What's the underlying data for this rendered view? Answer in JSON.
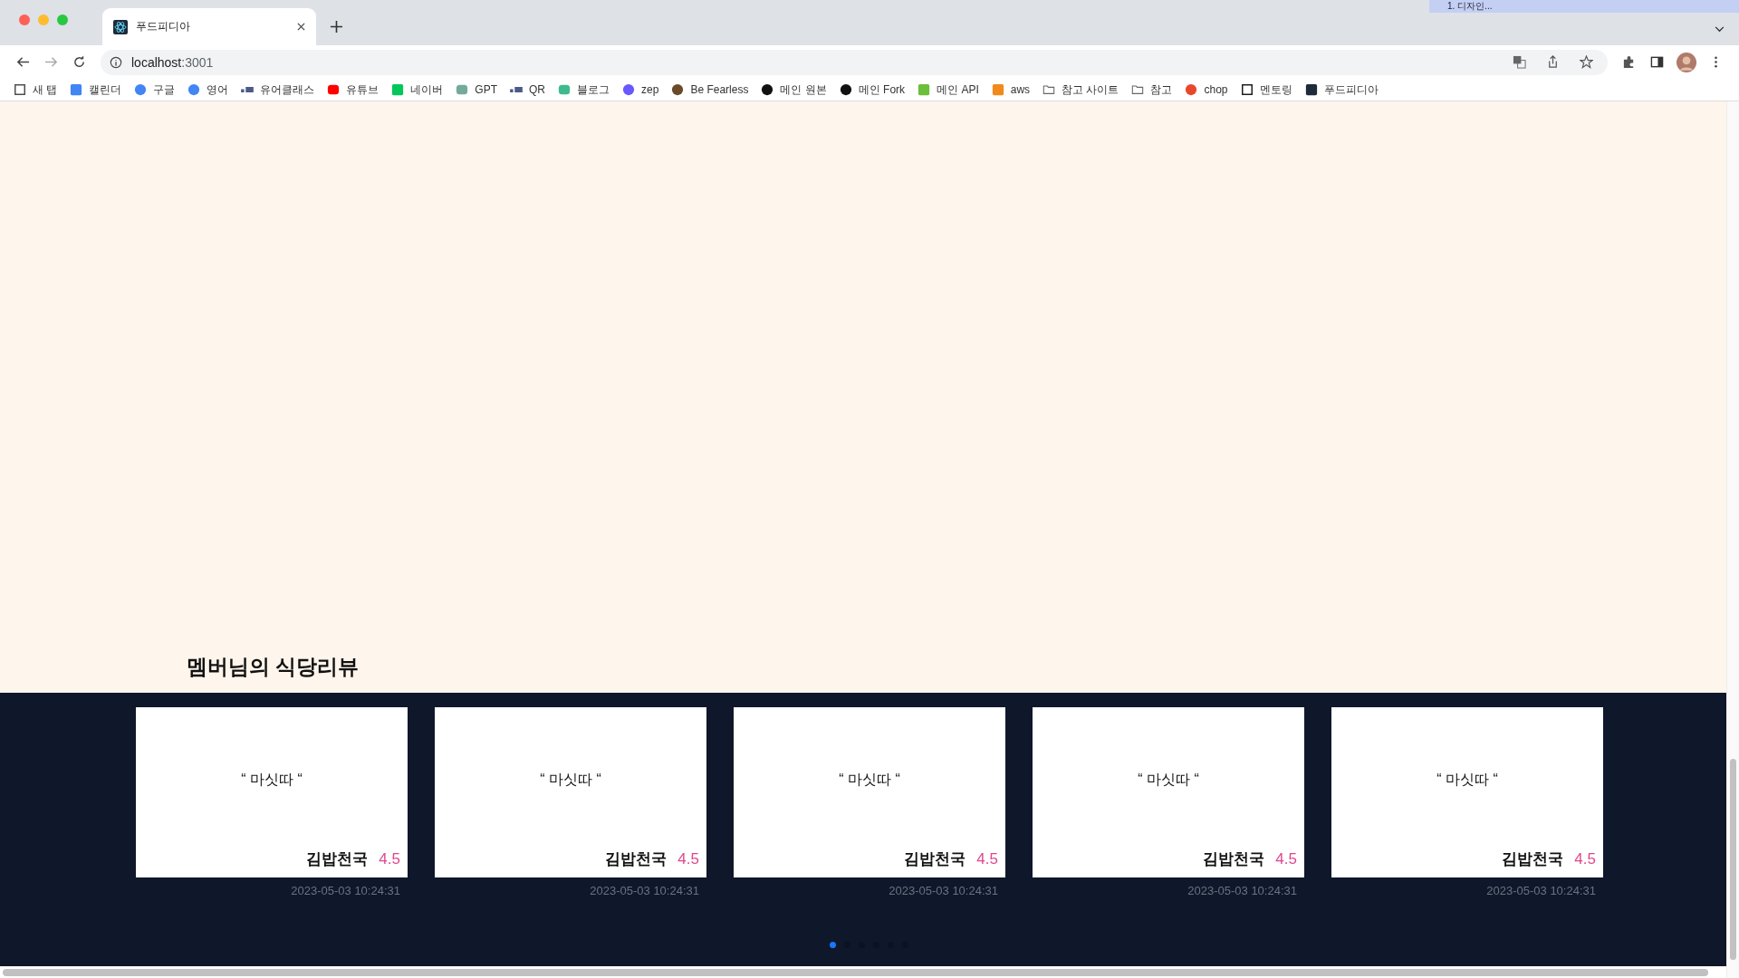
{
  "window": {
    "tab_title": "푸드피디아",
    "overlay_label": "1. 디자인..."
  },
  "address_bar": {
    "host": "localhost",
    "port": ":3001"
  },
  "bookmarks": [
    {
      "label": "새 탭",
      "kind": "page"
    },
    {
      "label": "캘린더",
      "kind": "calendar"
    },
    {
      "label": "구글",
      "kind": "google"
    },
    {
      "label": "영어",
      "kind": "google"
    },
    {
      "label": "유어클래스",
      "kind": "bars"
    },
    {
      "label": "유튜브",
      "kind": "youtube"
    },
    {
      "label": "네이버",
      "kind": "naver"
    },
    {
      "label": "GPT",
      "kind": "gpt"
    },
    {
      "label": "QR",
      "kind": "bars"
    },
    {
      "label": "블로그",
      "kind": "vlog"
    },
    {
      "label": "zep",
      "kind": "zep"
    },
    {
      "label": "Be Fearless",
      "kind": "eye"
    },
    {
      "label": "메인 원본",
      "kind": "github"
    },
    {
      "label": "메인 Fork",
      "kind": "github"
    },
    {
      "label": "메인 API",
      "kind": "puzzle"
    },
    {
      "label": "aws",
      "kind": "cube"
    },
    {
      "label": "참고 사이트",
      "kind": "folder"
    },
    {
      "label": "참고",
      "kind": "folder"
    },
    {
      "label": "chop",
      "kind": "tomato"
    },
    {
      "label": "멘토링",
      "kind": "notion"
    },
    {
      "label": "푸드피디아",
      "kind": "react"
    }
  ],
  "section_title": "멤버님의 식당리뷰",
  "reviews": [
    {
      "quote": "“ 마싯따 “",
      "restaurant": "김밥천국",
      "rating": "4.5",
      "date": "2023-05-03 10:24:31"
    },
    {
      "quote": "“ 마싯따 “",
      "restaurant": "김밥천국",
      "rating": "4.5",
      "date": "2023-05-03 10:24:31"
    },
    {
      "quote": "“ 마싯따 “",
      "restaurant": "김밥천국",
      "rating": "4.5",
      "date": "2023-05-03 10:24:31"
    },
    {
      "quote": "“ 마싯따 “",
      "restaurant": "김밥천국",
      "rating": "4.5",
      "date": "2023-05-03 10:24:31"
    },
    {
      "quote": "“ 마싯따 “",
      "restaurant": "김밥천국",
      "rating": "4.5",
      "date": "2023-05-03 10:24:31"
    }
  ],
  "pagination": [
    {
      "selected": true
    },
    {
      "selected": false
    },
    {
      "selected": false
    },
    {
      "selected": false
    },
    {
      "selected": false
    },
    {
      "selected": false
    }
  ]
}
